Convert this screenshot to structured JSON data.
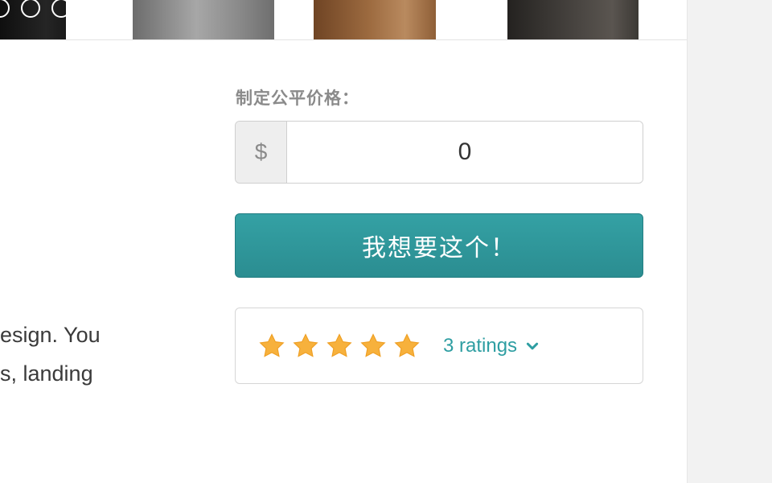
{
  "gallery": {
    "thumbnails": [
      "product-thumb-black",
      "product-thumb-grey",
      "product-thumb-brown",
      "product-thumb-dark"
    ],
    "indicator_count": 3
  },
  "description": {
    "lines": [
      "esign. You",
      "s, landing"
    ]
  },
  "pricing": {
    "label": "制定公平价格：",
    "currency_symbol": "$",
    "amount_value": "0"
  },
  "purchase": {
    "button_label": "我想要这个！"
  },
  "ratings": {
    "stars": 5,
    "link_text": "3 ratings",
    "star_color": "#f7b13c",
    "accent_color": "#2e9ea2"
  }
}
